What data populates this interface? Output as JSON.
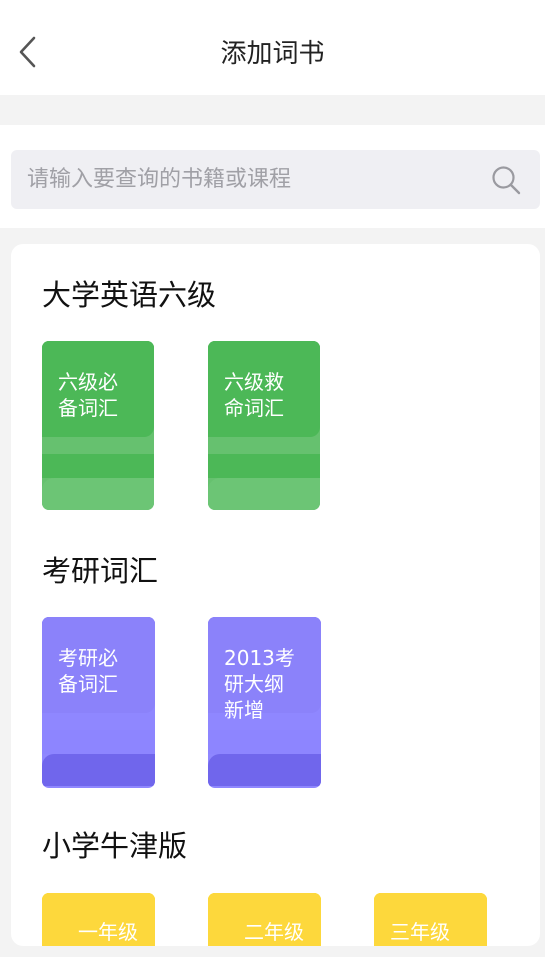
{
  "header": {
    "title": "添加词书",
    "back_icon": "chevron-left-icon"
  },
  "search": {
    "placeholder": "请输入要查询的书籍或课程",
    "icon": "search-icon"
  },
  "sections": [
    {
      "title": "大学英语六级",
      "color": "#4cb857",
      "books": [
        {
          "label": "六级必\n备词汇"
        },
        {
          "label": "六级救\n命词汇"
        }
      ]
    },
    {
      "title": "考研词汇",
      "color": "#8b82fa",
      "books": [
        {
          "label": "考研必\n备词汇"
        },
        {
          "label": "2013考\n研大纲\n新增"
        }
      ]
    },
    {
      "title": "小学牛津版",
      "color": "#ffe10a",
      "books": [
        {
          "label": "一年级"
        },
        {
          "label": "二年级"
        },
        {
          "label": "三年级"
        }
      ]
    }
  ]
}
